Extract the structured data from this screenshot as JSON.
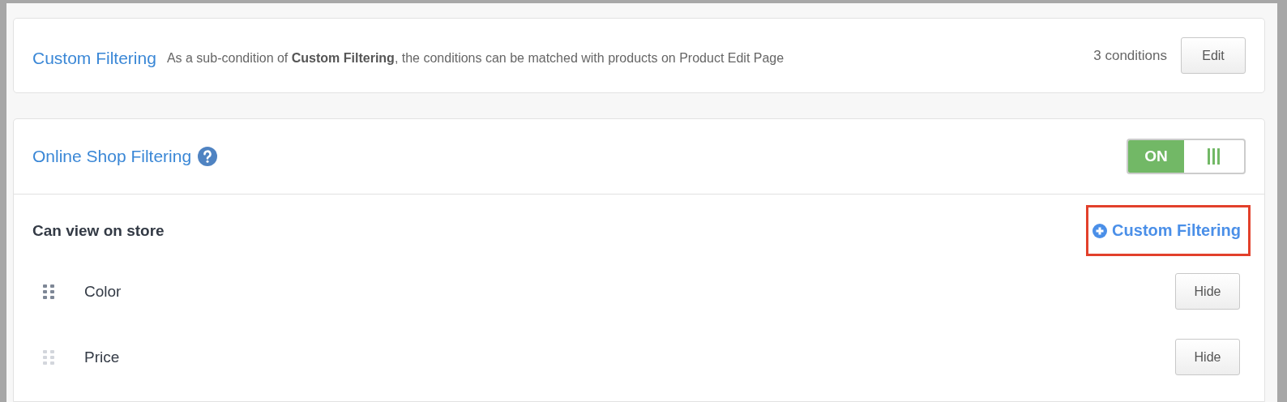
{
  "custom_filtering_card": {
    "title": "Custom Filtering",
    "description": "As a sub-condition of **Custom Filtering**, the conditions can be matched with products on Product Edit Page",
    "count": "3 conditions",
    "button": "Edit"
  },
  "online_shop_card": {
    "title": "Online Shop Filtering",
    "toggle": {
      "label": "ON",
      "on": true
    },
    "section_title": "Can view on store",
    "add_link": {
      "label": "Custom Filtering",
      "highlighted": true
    },
    "rows": [
      {
        "label": "Color",
        "button": "Hide",
        "handle_active": true
      },
      {
        "label": "Price",
        "button": "Hide",
        "handle_active": false
      }
    ]
  }
}
